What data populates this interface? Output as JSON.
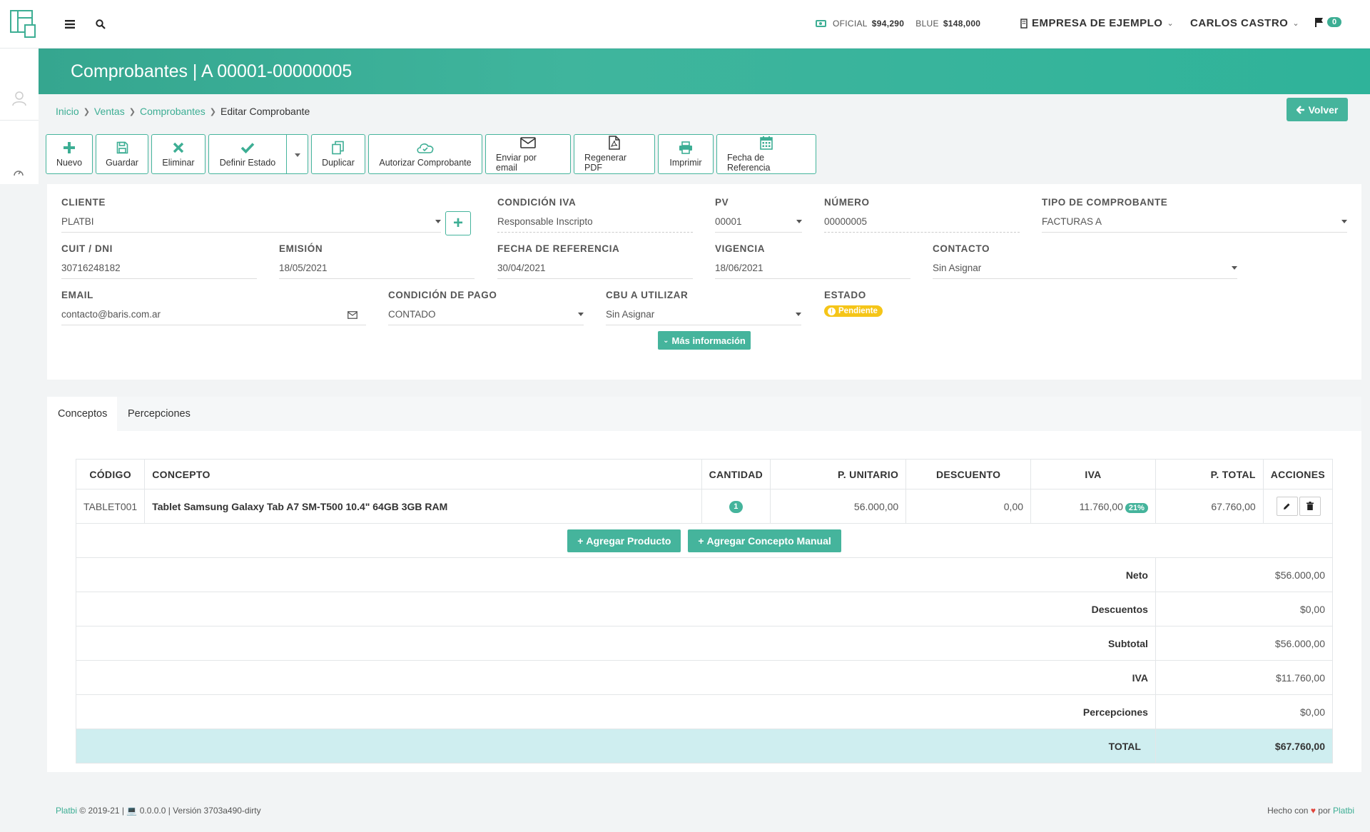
{
  "topbar": {
    "rates": {
      "oficial_label": "OFICIAL",
      "oficial_value": "$94,290",
      "blue_label": "BLUE",
      "blue_value": "$148,000"
    },
    "company": "EMPRESA DE EJEMPLO",
    "user": "CARLOS CASTRO",
    "notifications": "0"
  },
  "header": {
    "title": "Comprobantes | A 00001-00000005"
  },
  "breadcrumb": {
    "inicio": "Inicio",
    "ventas": "Ventas",
    "comprobantes": "Comprobantes",
    "current": "Editar Comprobante"
  },
  "volver_label": "Volver",
  "toolbar": {
    "nuevo": "Nuevo",
    "guardar": "Guardar",
    "eliminar": "Eliminar",
    "definir_estado": "Definir Estado",
    "duplicar": "Duplicar",
    "autorizar": "Autorizar Comprobante",
    "enviar_email": "Enviar por email",
    "regenerar_pdf": "Regenerar PDF",
    "imprimir": "Imprimir",
    "fecha_referencia": "Fecha de Referencia"
  },
  "form": {
    "cliente": {
      "label": "CLIENTE",
      "value": "PLATBI"
    },
    "condicion_iva": {
      "label": "CONDICIÓN IVA",
      "value": "Responsable Inscripto"
    },
    "pv": {
      "label": "PV",
      "value": "00001"
    },
    "numero": {
      "label": "NÚMERO",
      "value": "00000005"
    },
    "tipo": {
      "label": "TIPO DE COMPROBANTE",
      "value": "FACTURAS A"
    },
    "cuit": {
      "label": "CUIT / DNI",
      "value": "30716248182"
    },
    "emision": {
      "label": "EMISIÓN",
      "value": "18/05/2021"
    },
    "fecha_ref": {
      "label": "FECHA DE REFERENCIA",
      "value": "30/04/2021"
    },
    "vigencia": {
      "label": "VIGENCIA",
      "value": "18/06/2021"
    },
    "contacto": {
      "label": "CONTACTO",
      "value": "Sin Asignar"
    },
    "email": {
      "label": "EMAIL",
      "value": "contacto@baris.com.ar"
    },
    "condicion_pago": {
      "label": "CONDICIÓN DE PAGO",
      "value": "CONTADO"
    },
    "cbu": {
      "label": "CBU A UTILIZAR",
      "value": "Sin Asignar"
    },
    "estado": {
      "label": "ESTADO",
      "value": "Pendiente"
    },
    "mas_info": "Más información"
  },
  "tabs": {
    "conceptos": "Conceptos",
    "percepciones": "Percepciones"
  },
  "table": {
    "headers": {
      "codigo": "CÓDIGO",
      "concepto": "CONCEPTO",
      "cantidad": "CANTIDAD",
      "p_unitario": "P. UNITARIO",
      "descuento": "DESCUENTO",
      "iva": "IVA",
      "p_total": "P. TOTAL",
      "acciones": "ACCIONES"
    },
    "rows": [
      {
        "codigo": "TABLET001",
        "concepto": "Tablet Samsung Galaxy Tab A7 SM-T500 10.4\" 64GB 3GB RAM",
        "cantidad": "1",
        "p_unitario": "56.000,00",
        "descuento": "0,00",
        "iva": "11.760,00",
        "iva_rate": "21%",
        "p_total": "67.760,00"
      }
    ],
    "agregar_producto": "Agregar Producto",
    "agregar_concepto": "Agregar Concepto Manual"
  },
  "totals": {
    "neto": {
      "label": "Neto",
      "value": "$56.000,00"
    },
    "descuentos": {
      "label": "Descuentos",
      "value": "$0,00"
    },
    "subtotal": {
      "label": "Subtotal",
      "value": "$56.000,00"
    },
    "iva": {
      "label": "IVA",
      "value": "$11.760,00"
    },
    "percepciones": {
      "label": "Percepciones",
      "value": "$0,00"
    },
    "total": {
      "label": "TOTAL",
      "value": "$67.760,00"
    }
  },
  "footer": {
    "brand": "Platbi",
    "copyright": "© 2019-21 |",
    "version_num": "0.0.0.0",
    "version_build": "| Versión 3703a490-dirty",
    "made_with": "Hecho con",
    "by": "por",
    "brand2": "Platbi"
  },
  "colors": {
    "accent": "#45b49c",
    "pending": "#f5c518",
    "total_row": "#cfeef0"
  }
}
